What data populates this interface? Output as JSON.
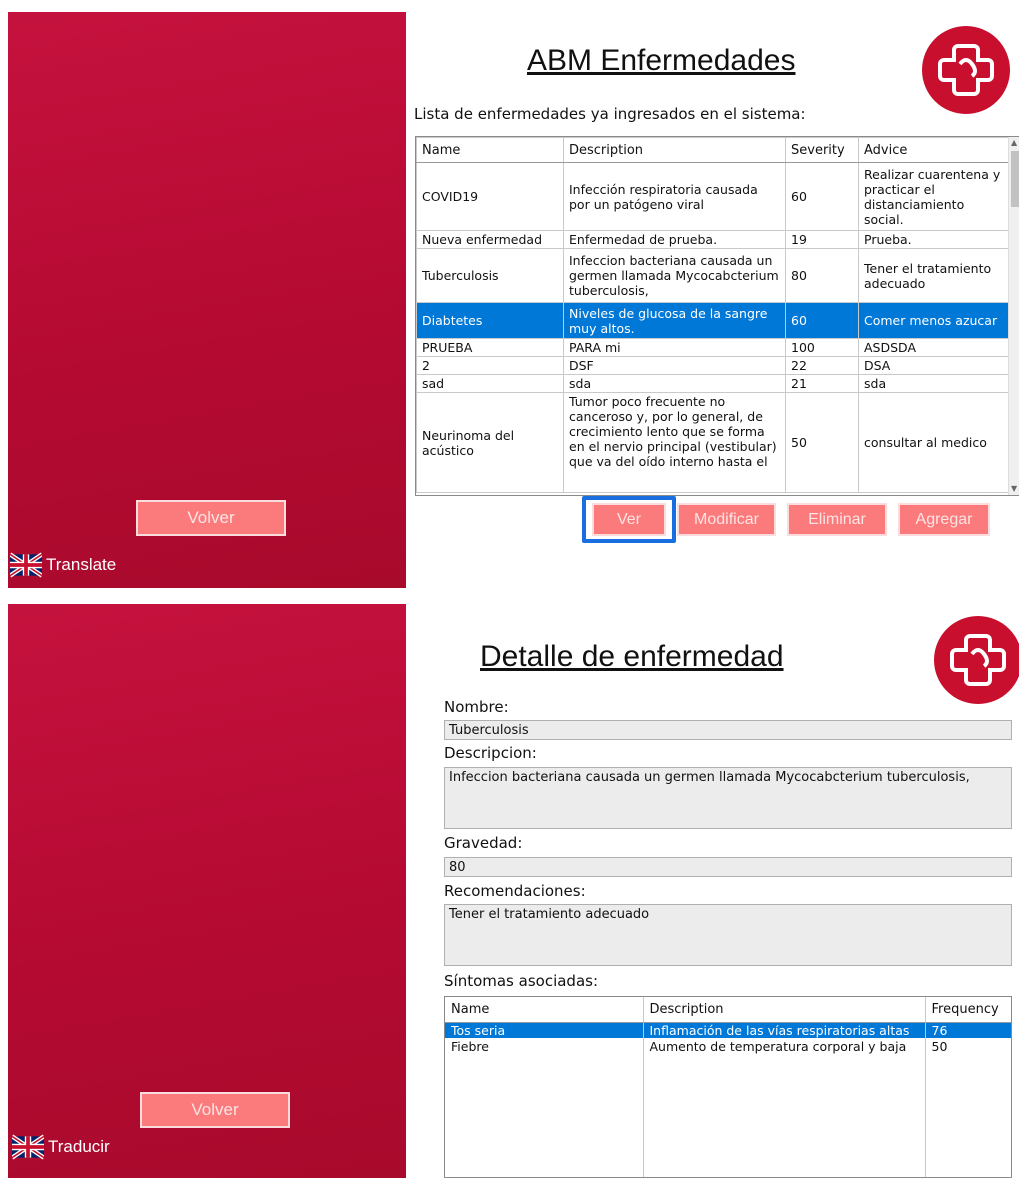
{
  "common": {
    "volver_label": "Volver",
    "accent_color": "#c8102e",
    "button_color": "#fb7a7c",
    "selection_color": "#0078d7"
  },
  "top": {
    "translate_label": "Translate",
    "title": "ABM Enfermedades",
    "list_caption": "Lista de enfermedades ya ingresados en el sistema:",
    "columns": [
      "Name",
      "Description",
      "Severity",
      "Advice"
    ],
    "rows": [
      {
        "name": "COVID19",
        "description": "Infección respiratoria causada por un patógeno viral",
        "severity": "60",
        "advice": "Realizar cuarentena y practicar el distanciamiento social."
      },
      {
        "name": "Nueva enfermedad",
        "description": "Enfermedad de prueba.",
        "severity": "19",
        "advice": "Prueba."
      },
      {
        "name": "Tuberculosis",
        "description": "Infeccion bacteriana causada un germen llamada Mycocabcterium tuberculosis,",
        "severity": "80",
        "advice": "Tener el tratamiento adecuado"
      },
      {
        "name": "Diabtetes",
        "description": "Niveles de glucosa de la sangre muy altos.",
        "severity": "60",
        "advice": "Comer menos azucar"
      },
      {
        "name": "PRUEBA",
        "description": "PARA mi",
        "severity": "100",
        "advice": "ASDSDA"
      },
      {
        "name": "2",
        "description": "DSF",
        "severity": "22",
        "advice": "DSA"
      },
      {
        "name": "sad",
        "description": "sda",
        "severity": "21",
        "advice": "sda"
      },
      {
        "name": "Neurinoma del acústico",
        "description": "Tumor poco frecuente no canceroso y, por lo general, de crecimiento lento que se forma en el nervio principal (vestibular) que va del oído interno hasta el",
        "severity": "50",
        "advice": "consultar al medico"
      }
    ],
    "selected_row": "Diabtetes",
    "buttons": {
      "ver": "Ver",
      "modificar": "Modificar",
      "eliminar": "Eliminar",
      "agregar": "Agregar"
    }
  },
  "bottom": {
    "translate_label": "Traducir",
    "title": "Detalle de enfermedad",
    "nombre_label": "Nombre:",
    "nombre_value": "Tuberculosis",
    "descripcion_label": "Descripcion:",
    "descripcion_value": "Infeccion bacteriana causada un germen llamada Mycocabcterium tuberculosis,",
    "gravedad_label": "Gravedad:",
    "gravedad_value": "80",
    "recomendaciones_label": "Recomendaciones:",
    "recomendaciones_value": "Tener el tratamiento adecuado",
    "sintomas_label": "Síntomas asociadas:",
    "symptom_columns": [
      "Name",
      "Description",
      "Frequency"
    ],
    "symptoms": [
      {
        "name": "Tos seria",
        "description": "Inflamación de las vías respiratorias altas",
        "frequency": "76"
      },
      {
        "name": "Fiebre",
        "description": "Aumento de temperatura corporal y baja",
        "frequency": "50"
      }
    ]
  }
}
